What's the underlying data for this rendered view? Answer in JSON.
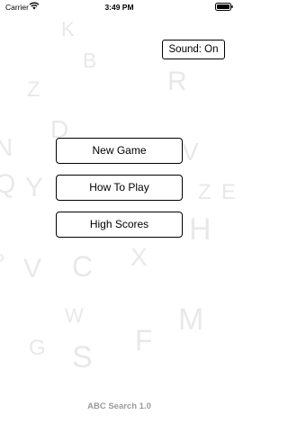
{
  "status_bar": {
    "carrier": "Carrier",
    "time": "3:49 PM"
  },
  "background_letters": [
    "K",
    "B",
    "R",
    "Z",
    "D",
    "N",
    "V",
    "Q",
    "Y",
    "Z",
    "E",
    "H",
    "P",
    "V",
    "C",
    "X",
    "W",
    "M",
    "G",
    "S",
    "F"
  ],
  "sound_button": {
    "label": "Sound: On"
  },
  "menu": {
    "new_game": "New Game",
    "how_to_play": "How To Play",
    "high_scores": "High Scores"
  },
  "footer": {
    "version": "ABC Search 1.0"
  }
}
